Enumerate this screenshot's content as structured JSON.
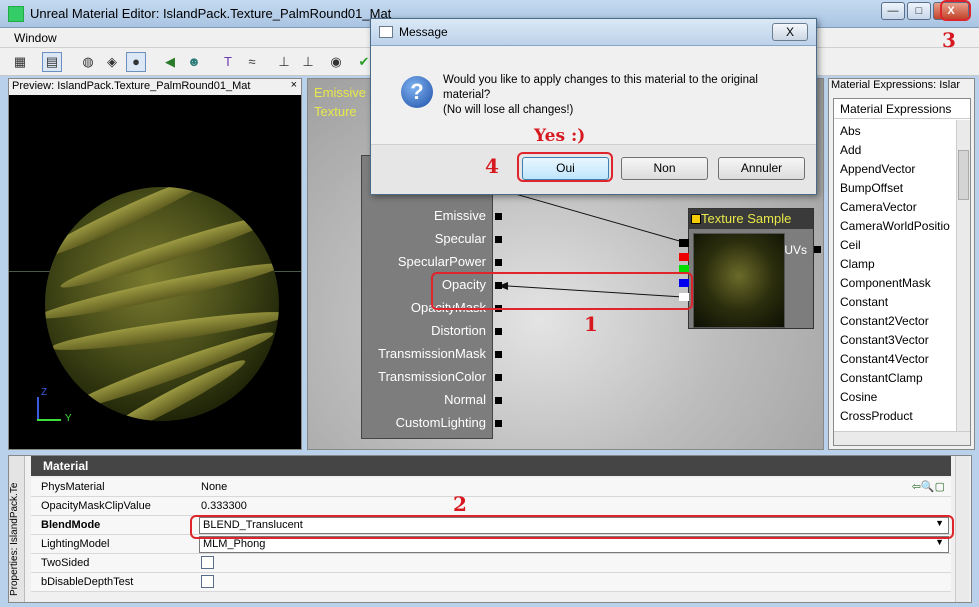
{
  "window": {
    "title": "Unreal Material Editor: IslandPack.Texture_PalmRound01_Mat",
    "min_icon": "minimize-icon",
    "max_icon": "maximize-icon",
    "close_icon": "close-icon"
  },
  "menu": {
    "window_label": "Window"
  },
  "toolbar": {
    "icons": [
      "home-icon",
      "grid-icon",
      "cylinder-icon",
      "cube-icon",
      "sphere-icon",
      "back-arrow-icon",
      "alien-head-icon",
      "pin-icon",
      "wave-icon",
      "node-icon",
      "node2-icon",
      "eye-icon",
      "check-icon"
    ]
  },
  "preview": {
    "title": "Preview: IslandPack.Texture_PalmRound01_Mat",
    "close": "×",
    "axis_z": "Z",
    "axis_y": "Y"
  },
  "graph": {
    "top_labels": [
      "Emissive",
      "Texture"
    ],
    "inputs": [
      "Emissive",
      "Specular",
      "SpecularPower",
      "Opacity",
      "OpacityMask",
      "Distortion",
      "TransmissionMask",
      "TransmissionColor",
      "Normal",
      "CustomLighting"
    ],
    "texture_node_title": "Texture Sample",
    "uvs_label": "UVs"
  },
  "right_panel": {
    "title": "Material Expressions: Islar",
    "list_header": "Material Expressions",
    "items": [
      "Abs",
      "Add",
      "AppendVector",
      "BumpOffset",
      "CameraVector",
      "CameraWorldPositio",
      "Ceil",
      "Clamp",
      "ComponentMask",
      "Constant",
      "Constant2Vector",
      "Constant3Vector",
      "Constant4Vector",
      "ConstantClamp",
      "Cosine",
      "CrossProduct"
    ]
  },
  "properties": {
    "side_label": "Properties: IslandPack.Te",
    "category": "Material",
    "rows": [
      {
        "name": "PhysMaterial",
        "value": "None"
      },
      {
        "name": "OpacityMaskClipValue",
        "value": "0.333300"
      },
      {
        "name": "BlendMode",
        "value": "BLEND_Translucent"
      },
      {
        "name": "LightingModel",
        "value": "MLM_Phong"
      },
      {
        "name": "TwoSided",
        "value": ""
      },
      {
        "name": "bDisableDepthTest",
        "value": ""
      }
    ]
  },
  "dialog": {
    "title": "Message",
    "close": "X",
    "line1": "Would you like to apply changes to this material to the original",
    "line2": "material?",
    "line3": "(No will lose all changes!)",
    "btn_yes": "Oui",
    "btn_no": "Non",
    "btn_cancel": "Annuler"
  },
  "annotations": {
    "n1": "1",
    "n2": "2",
    "n3": "3",
    "n4": "4",
    "yes": "Yes :)",
    "color": "#e0242b"
  }
}
